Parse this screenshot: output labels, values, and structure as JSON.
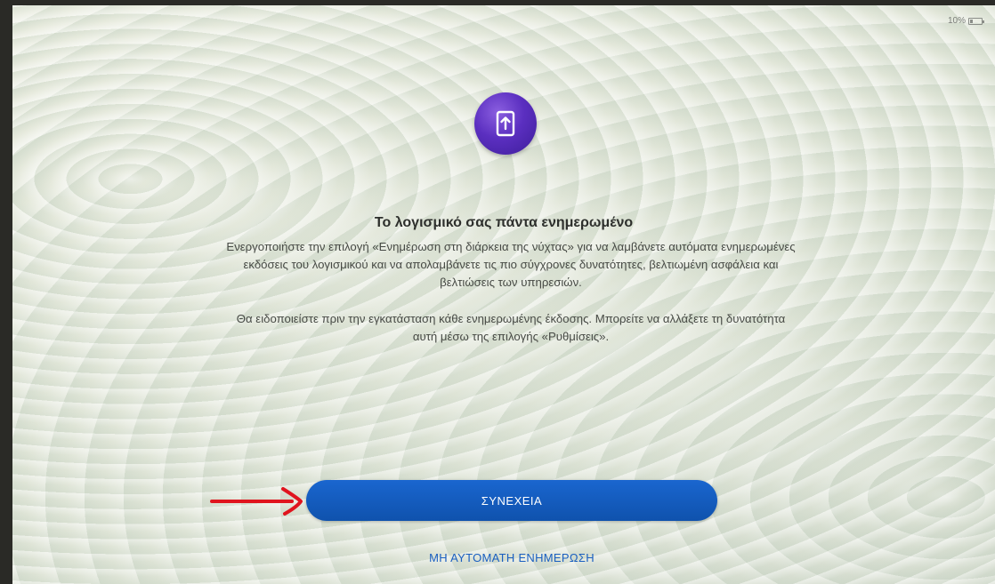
{
  "status_bar": {
    "battery_percent": "10%",
    "battery_level": 0.1
  },
  "header": {
    "icon": "phone-update-arrow-icon",
    "title": "Το λογισμικό σας πάντα ενημερωμένο"
  },
  "body": {
    "paragraph_1_line_1": "Ενεργοποιήστε την επιλογή «Ενημέρωση στη διάρκεια της νύχτας» για να λαμβάνετε αυτόματα ενημερωμένες",
    "paragraph_1_line_2": "εκδόσεις του λογισμικού και να απολαμβάνετε τις πιο σύγχρονες δυνατότητες, βελτιωμένη ασφάλεια και",
    "paragraph_1_line_3": "βελτιώσεις των υπηρεσιών.",
    "paragraph_2_line_1": "Θα ειδοποιείστε πριν την εγκατάσταση κάθε ενημερωμένης έκδοσης. Μπορείτε να αλλάξετε τη δυνατότητα",
    "paragraph_2_line_2": "αυτή μέσω της επιλογής «Ρυθμίσεις»."
  },
  "actions": {
    "continue_label": "ΣΥΝΕΧΕΙΑ",
    "skip_label": "ΜΗ ΑΥΤΟΜΑΤΗ ΕΝΗΜΕΡΩΣΗ"
  },
  "annotation": {
    "arrow": "red-arrow-icon"
  },
  "colors": {
    "primary_button": "#1464c8",
    "badge_purple": "#5b2fc0",
    "link_blue": "#1a5fc0",
    "annotation_red": "#e0141e"
  }
}
